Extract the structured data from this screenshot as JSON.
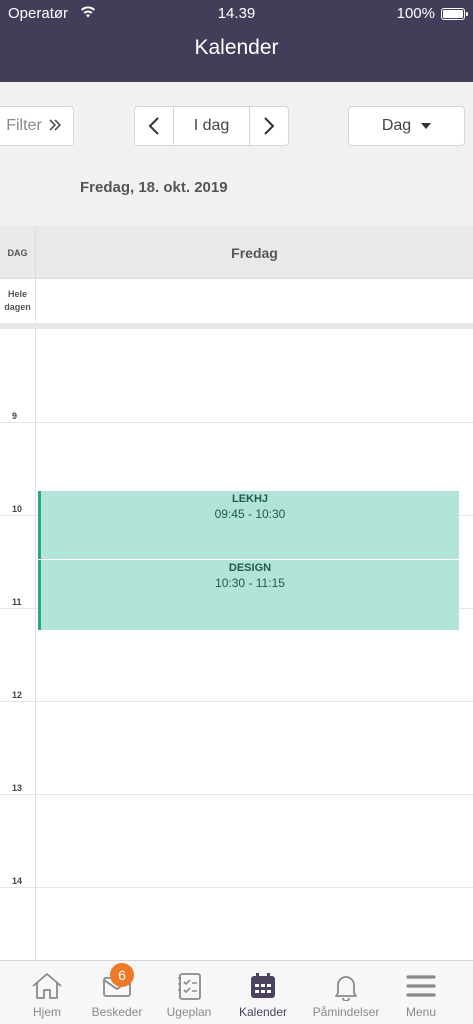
{
  "status_bar": {
    "carrier": "Operatør",
    "time": "14.39",
    "battery": "100%"
  },
  "nav": {
    "title": "Kalender"
  },
  "toolbar": {
    "filter_label": "Filter",
    "today_label": "I dag",
    "view_label": "Dag"
  },
  "date_title": "Fredag, 18. okt. 2019",
  "calendar": {
    "header_label": "DAG",
    "day_name": "Fredag",
    "allday_label_line1": "Hele",
    "allday_label_line2": "dagen",
    "hours": [
      "9",
      "10",
      "11",
      "12",
      "13",
      "14"
    ],
    "events": [
      {
        "title": "LEKHJ",
        "time": "09:45 - 10:30",
        "color": "#b3e4d9"
      },
      {
        "title": "DESIGN",
        "time": "10:30 - 11:15",
        "color": "#b3e4d9"
      }
    ]
  },
  "tabs": [
    {
      "label": "Hjem",
      "icon": "home-icon"
    },
    {
      "label": "Beskeder",
      "icon": "mail-icon",
      "badge": "6"
    },
    {
      "label": "Ugeplan",
      "icon": "checklist-icon"
    },
    {
      "label": "Kalender",
      "icon": "calendar-icon",
      "active": true
    },
    {
      "label": "Påmindelser",
      "icon": "bell-icon"
    },
    {
      "label": "Menu",
      "icon": "hamburger-icon"
    }
  ],
  "colors": {
    "header": "#443d5a",
    "accent": "#4b4260",
    "event_fill": "#b3e4d9",
    "event_border": "#2aa58a",
    "badge": "#ee7a27"
  }
}
